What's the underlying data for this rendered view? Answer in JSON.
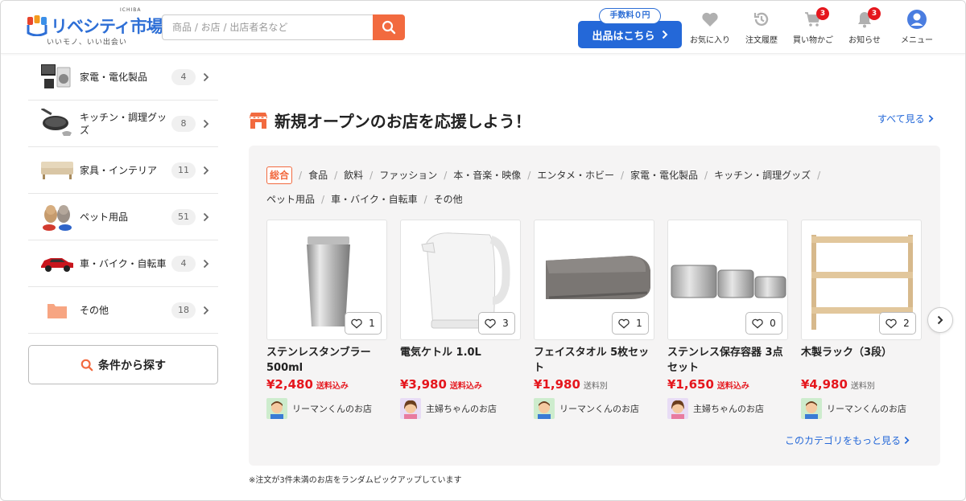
{
  "header": {
    "logo_main": "リベシティ市場",
    "logo_ichiba": "ICHIBA",
    "logo_sub": "いいモノ、いい出会い",
    "search_placeholder": "商品 / お店 / 出店者名など",
    "listing_badge": "手数料０円",
    "listing_label": "出品はこちら",
    "nav": [
      {
        "label": "お気に入り",
        "icon": "heart-icon"
      },
      {
        "label": "注文履歴",
        "icon": "history-icon"
      },
      {
        "label": "買い物かご",
        "icon": "cart-icon",
        "badge": "3"
      },
      {
        "label": "お知らせ",
        "icon": "bell-icon",
        "badge": "3"
      },
      {
        "label": "メニュー",
        "icon": "user-icon"
      }
    ]
  },
  "sidebar": {
    "categories": [
      {
        "label": "家電・電化製品",
        "count": "4",
        "icon": "appliance-thumbnail"
      },
      {
        "label": "キッチン・調理グッズ",
        "count": "8",
        "icon": "kitchen-thumbnail"
      },
      {
        "label": "家具・インテリア",
        "count": "11",
        "icon": "furniture-thumbnail"
      },
      {
        "label": "ペット用品",
        "count": "51",
        "icon": "pet-thumbnail"
      },
      {
        "label": "車・バイク・自転車",
        "count": "4",
        "icon": "car-thumbnail"
      },
      {
        "label": "その他",
        "count": "18",
        "icon": "folder-icon"
      }
    ],
    "search_condition_label": "条件から探す"
  },
  "main": {
    "section_title": "新規オープンのお店を応援しよう！",
    "see_all": "すべて見る",
    "tabs": [
      "総合",
      "食品",
      "飲料",
      "ファッション",
      "本・音楽・映像",
      "エンタメ・ホビー",
      "家電・電化製品",
      "キッチン・調理グッズ",
      "ペット用品",
      "車・バイク・自転車",
      "その他"
    ],
    "active_tab": "総合",
    "products": [
      {
        "name": "ステンレスタンブラー 500ml",
        "price": "¥2,480",
        "shipping": "送料込み",
        "shipping_included": true,
        "favorites": "1",
        "shop": "リーマンくんのお店",
        "image": "tumbler"
      },
      {
        "name": "電気ケトル 1.0L",
        "price": "¥3,980",
        "shipping": "送料込み",
        "shipping_included": true,
        "favorites": "3",
        "shop": "主婦ちゃんのお店",
        "image": "kettle"
      },
      {
        "name": "フェイスタオル 5枚セット",
        "price": "¥1,980",
        "shipping": "送料別",
        "shipping_included": false,
        "favorites": "1",
        "shop": "リーマンくんのお店",
        "image": "towel"
      },
      {
        "name": "ステンレス保存容器 3点セット",
        "price": "¥1,650",
        "shipping": "送料込み",
        "shipping_included": true,
        "favorites": "0",
        "shop": "主婦ちゃんのお店",
        "image": "containers"
      },
      {
        "name": "木製ラック（3段）",
        "price": "¥4,980",
        "shipping": "送料別",
        "shipping_included": false,
        "favorites": "2",
        "shop": "リーマンくんのお店",
        "image": "rack"
      }
    ],
    "more_in_category": "このカテゴリをもっと見る",
    "note": "※注文が3件未満のお店をランダムピックアップしています"
  },
  "colors": {
    "accent_orange": "#f26a3f",
    "primary_blue": "#2468d8",
    "price_red": "#e5161d",
    "panel_bg": "#f5f4f4"
  }
}
